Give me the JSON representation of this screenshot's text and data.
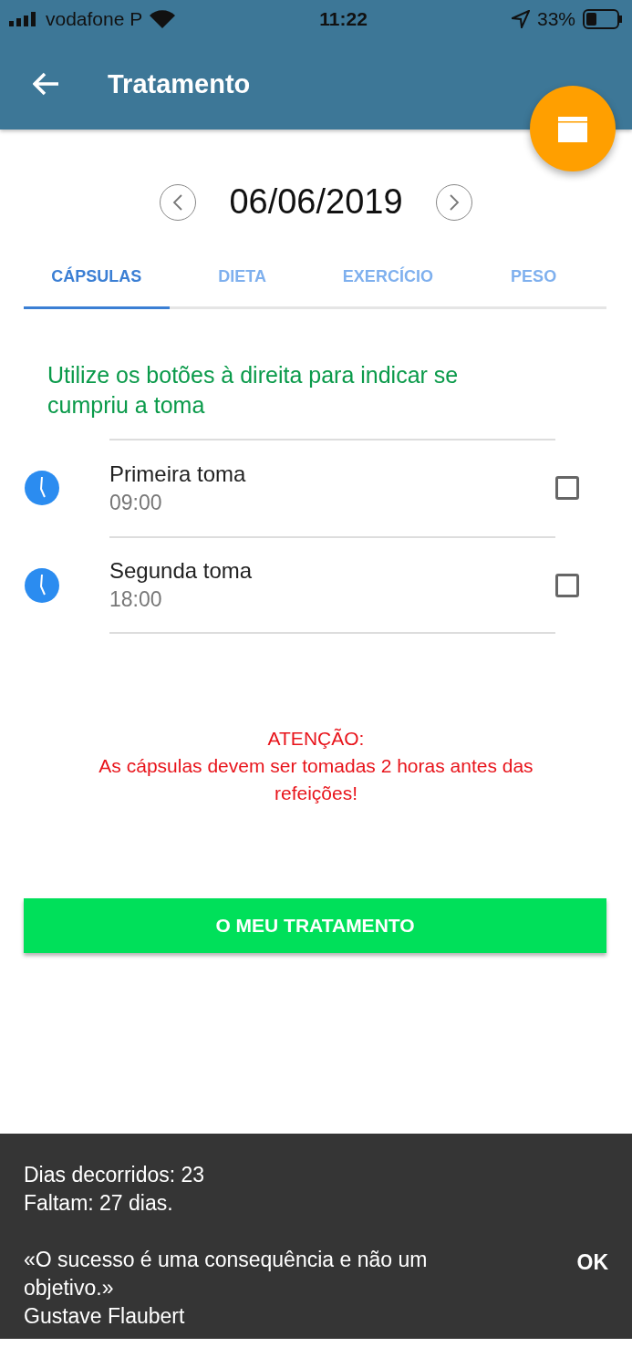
{
  "status_bar": {
    "carrier": "vodafone P",
    "time": "11:22",
    "battery": "33%"
  },
  "app_bar": {
    "title": "Tratamento"
  },
  "date_nav": {
    "date": "06/06/2019"
  },
  "tabs": [
    {
      "label": "CÁPSULAS",
      "selected": true
    },
    {
      "label": "DIETA",
      "selected": false
    },
    {
      "label": "EXERCÍCIO",
      "selected": false
    },
    {
      "label": "PESO",
      "selected": false
    }
  ],
  "instruction": "Utilize os botões à direita para indicar se cumpriu a toma",
  "doses": [
    {
      "name": "Primeira toma",
      "time": "09:00",
      "checked": false
    },
    {
      "name": "Segunda toma",
      "time": "18:00",
      "checked": false
    }
  ],
  "warning": {
    "title": "ATENÇÃO:",
    "text": "As cápsulas devem ser tomadas 2 horas antes das refeições!"
  },
  "main_button": "O MEU TRATAMENTO",
  "snackbar": {
    "lines": [
      "Dias decorridos: 23",
      "Faltam: 27 dias."
    ],
    "quote": "«O sucesso é uma consequência e não um objetivo.»",
    "author": "Gustave Flaubert",
    "action": "OK"
  }
}
